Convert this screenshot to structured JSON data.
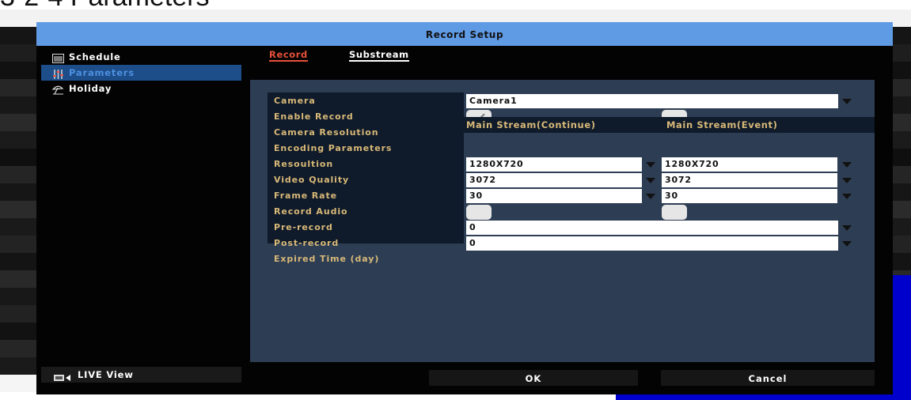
{
  "heading": "3-2-4 Parameters",
  "dialog": {
    "title": "Record Setup"
  },
  "sidebar": {
    "items": [
      {
        "label": "Schedule",
        "icon": "calendar-icon"
      },
      {
        "label": "Parameters",
        "icon": "sliders-icon"
      },
      {
        "label": "Holiday",
        "icon": "beach-umbrella-icon"
      }
    ],
    "live_view": "LIVE View"
  },
  "tabs": {
    "record": "Record",
    "substream": "Substream"
  },
  "form": {
    "labels": {
      "camera": "Camera",
      "enable_record": "Enable Record",
      "camera_resolution": "Camera Resolution",
      "encoding_parameters": "Encoding Parameters",
      "resolution": "Resoultion",
      "video_quality": "Video Quality",
      "frame_rate": "Frame Rate",
      "record_audio": "Record Audio",
      "pre_record": "Pre-record",
      "post_record": "Post-record",
      "expired_time": "Expired Time (day)"
    },
    "camera_value": "Camera1",
    "enable_record_main_checked": true,
    "enable_record_event_checked": false,
    "headers": {
      "main": "Main Stream(Continue)",
      "event": "Main Stream(Event)"
    },
    "main": {
      "resolution": "1280X720",
      "video_quality": "3072",
      "frame_rate": "30"
    },
    "event": {
      "resolution": "1280X720",
      "video_quality": "3072",
      "frame_rate": "30"
    },
    "pre_record": "0",
    "post_record": "0"
  },
  "buttons": {
    "ok": "OK",
    "cancel": "Cancel"
  },
  "colors": {
    "title_bar": "#5f9ae4",
    "label_gold": "#d8b978",
    "active_tab": "#e8503a",
    "panel": "#2d3d53"
  }
}
